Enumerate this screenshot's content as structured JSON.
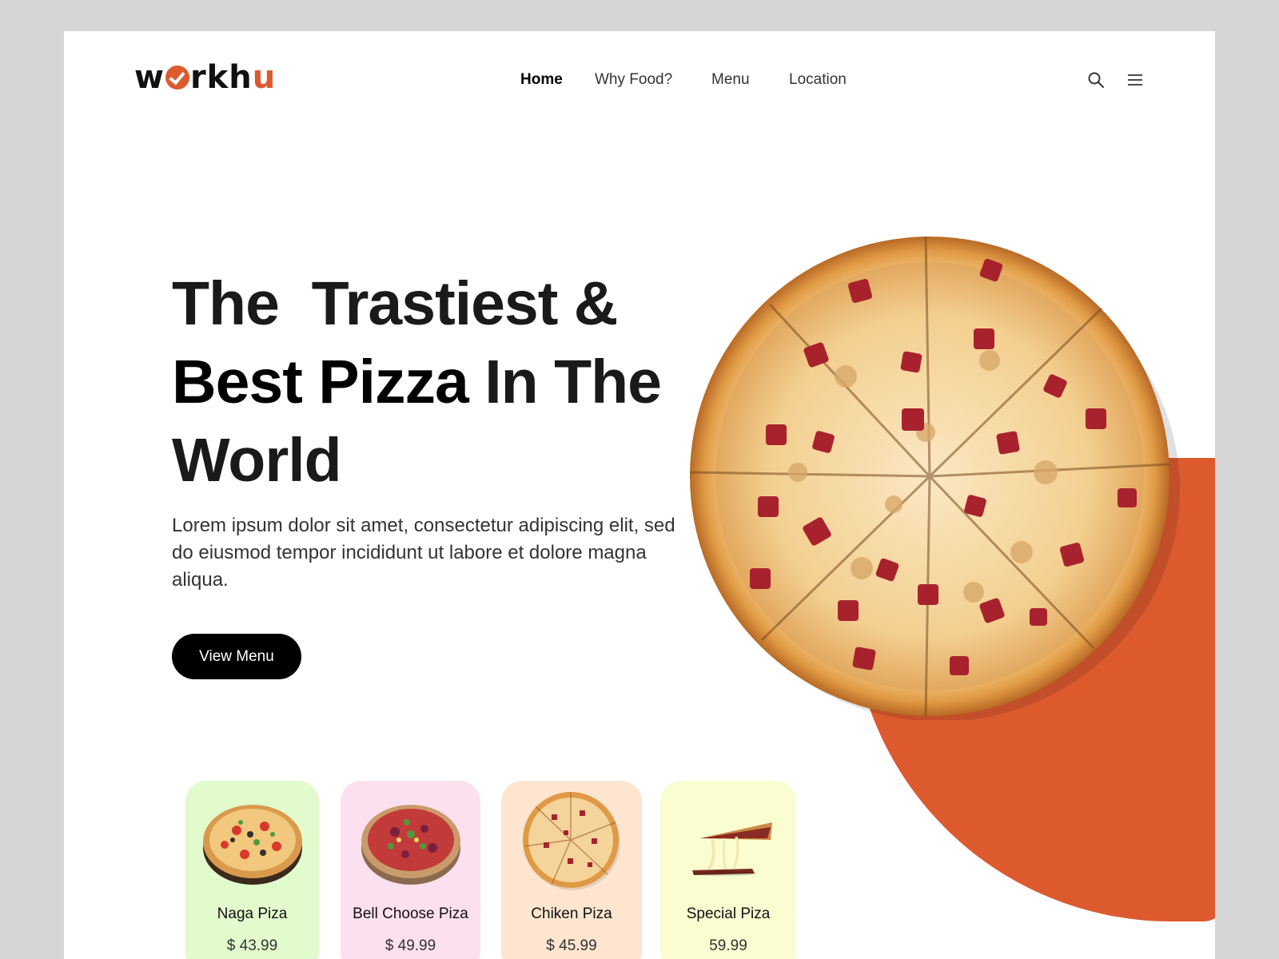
{
  "brand": {
    "logo_w": "w",
    "logo_rk": "rkh",
    "logo_u": "u",
    "accent": "#dd5a2f"
  },
  "nav": {
    "items": [
      {
        "label": "Home",
        "active": true
      },
      {
        "label": "Why Food?",
        "active": false
      },
      {
        "label": "Menu",
        "active": false
      },
      {
        "label": "Location",
        "active": false
      }
    ]
  },
  "header_icons": [
    "search-icon",
    "hamburger-menu-icon"
  ],
  "hero": {
    "title_line1": "The  Trastiest &",
    "title_bold": "Best Pizza",
    "title_rest": " In The",
    "title_line3": "World",
    "description": "Lorem ipsum dolor sit amet, consectetur adipiscing elit, sed do eiusmod tempor incididunt ut labore et dolore magna aliqua.",
    "cta_label": "View Menu"
  },
  "cards": [
    {
      "name": "Naga Piza",
      "price": "$ 43.99",
      "bg": "#e1fbcd"
    },
    {
      "name": "Bell Choose Piza",
      "price": "$ 49.99",
      "bg": "#fde0ef"
    },
    {
      "name": "Chiken Piza",
      "price": "$ 45.99",
      "bg": "#fde5cf"
    },
    {
      "name": "Special Piza",
      "price": "59.99",
      "bg": "#f9fdd0"
    }
  ]
}
